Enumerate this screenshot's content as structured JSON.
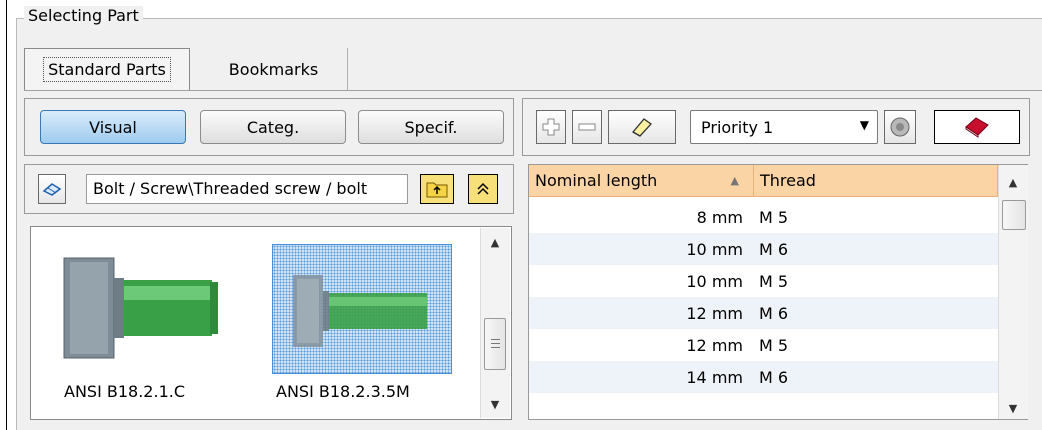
{
  "group_title": "Selecting Part",
  "tabs": [
    {
      "label": "Standard Parts",
      "active": true
    },
    {
      "label": "Bookmarks",
      "active": false
    }
  ],
  "view_buttons": [
    {
      "label": "Visual",
      "active": true
    },
    {
      "label": "Categ.",
      "active": false
    },
    {
      "label": "Specif.",
      "active": false
    }
  ],
  "category_path": "Bolt / Screw\\Threaded screw / bolt",
  "parts": [
    {
      "caption": "ANSI B18.2.1.C",
      "selected": false
    },
    {
      "caption": "ANSI B18.2.3.5M",
      "selected": true
    }
  ],
  "toolbar": {
    "priority_value": "Priority 1",
    "icons": [
      "add-icon",
      "remove-icon",
      "eraser-icon",
      "disc-icon",
      "book-icon"
    ]
  },
  "table": {
    "columns": [
      {
        "label": "Nominal length",
        "sort": "ascending"
      },
      {
        "label": "Thread"
      }
    ],
    "rows": [
      {
        "length": "8 mm",
        "thread": "M 5"
      },
      {
        "length": "10 mm",
        "thread": "M 6"
      },
      {
        "length": "10 mm",
        "thread": "M 5"
      },
      {
        "length": "12 mm",
        "thread": "M 6"
      },
      {
        "length": "12 mm",
        "thread": "M 5"
      },
      {
        "length": "14 mm",
        "thread": "M 6"
      }
    ]
  },
  "colors": {
    "header_bg": "#fbd4a6",
    "selected_tab_bg": "#9fcbee",
    "bolt_green": "#3aa047",
    "bolt_head": "#7d8c96",
    "book_red": "#c8102e"
  }
}
